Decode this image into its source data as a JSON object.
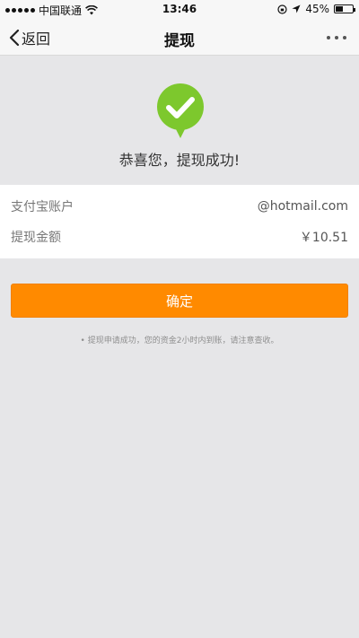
{
  "status_bar": {
    "carrier": "中国联通",
    "time": "13:46",
    "battery": "45%",
    "battery_level": 0.45
  },
  "nav": {
    "back_label": "返回",
    "title": "提现"
  },
  "success": {
    "message": "恭喜您，提现成功!"
  },
  "info": {
    "rows": [
      {
        "label": "支付宝账户",
        "value": "@hotmail.com"
      },
      {
        "label": "提现金额",
        "value": "￥10.51"
      }
    ]
  },
  "confirm": {
    "label": "确定"
  },
  "note": "• 提现申请成功，您的资金2小时内到账，请注意查收。",
  "colors": {
    "accent": "#ff8a00",
    "success": "#7dc82d"
  }
}
